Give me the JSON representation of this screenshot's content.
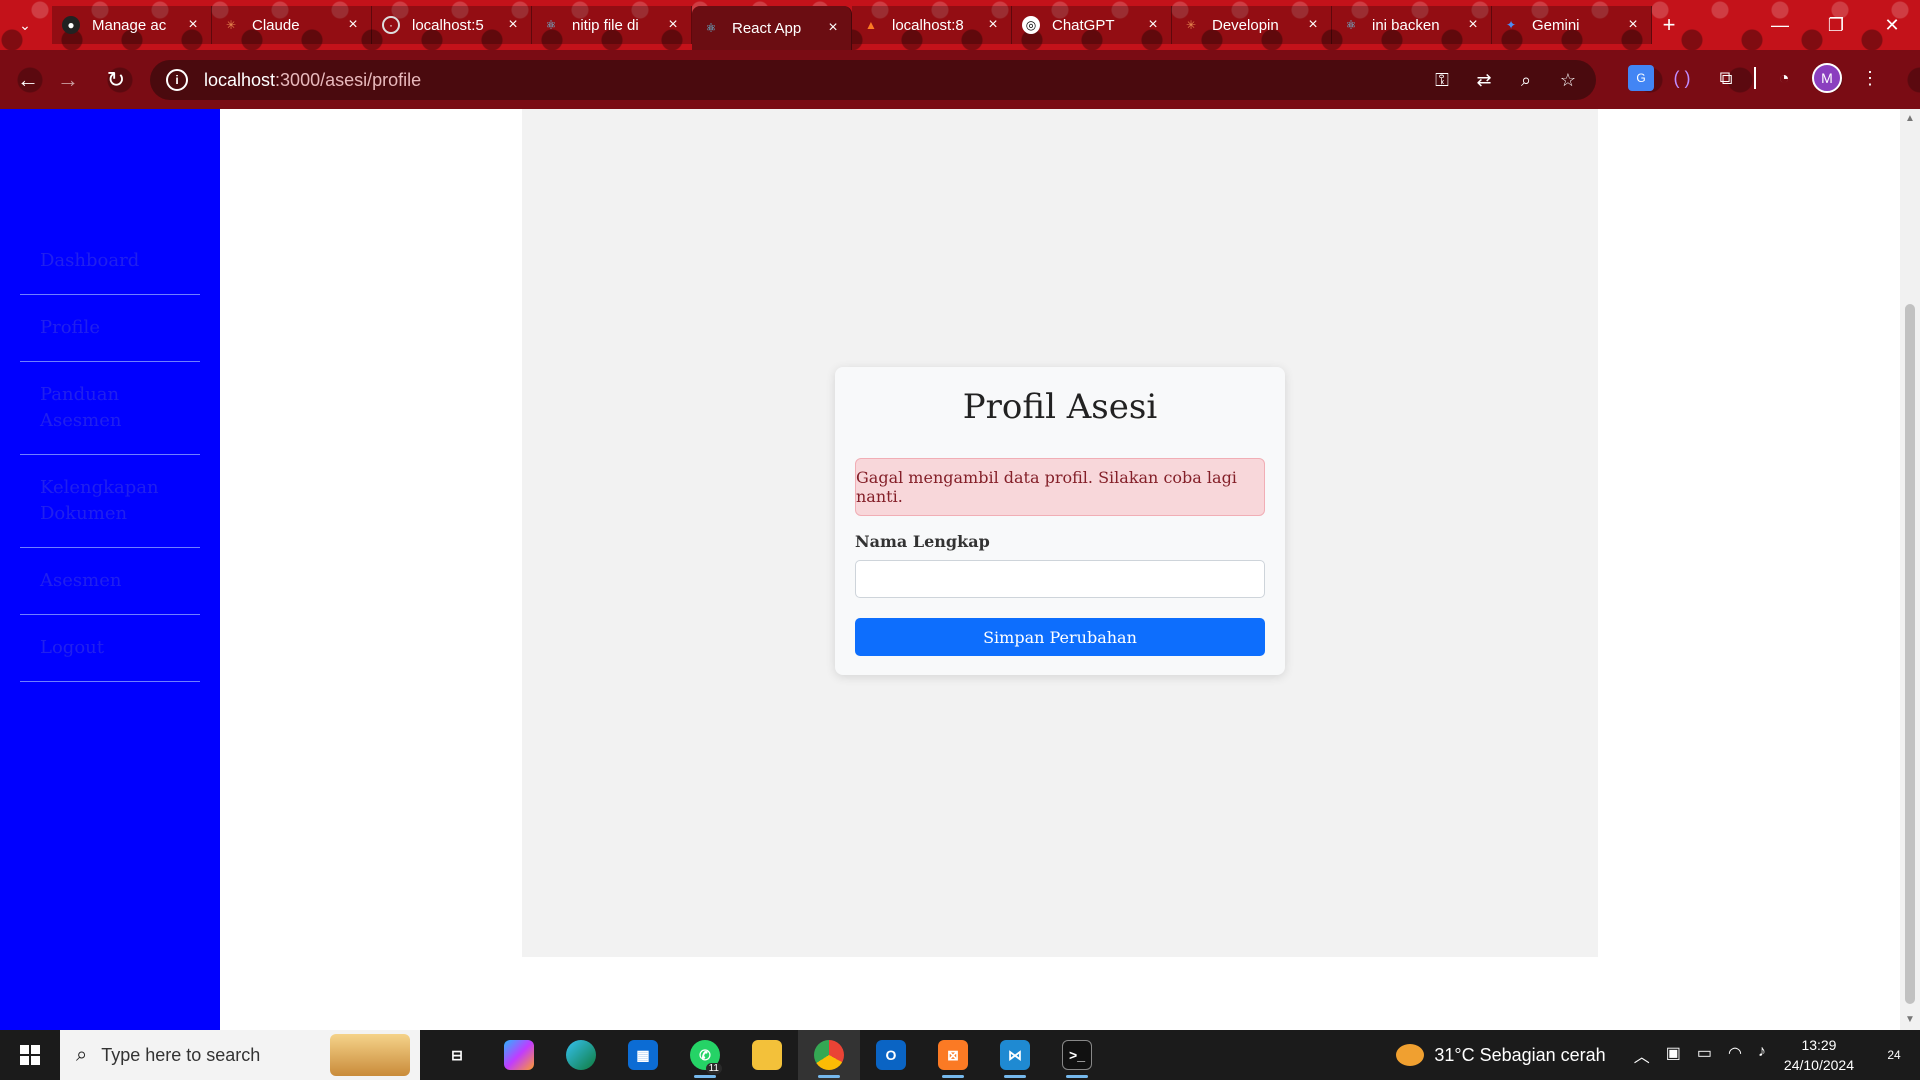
{
  "browser": {
    "tabs": [
      {
        "title": "Manage ac",
        "icon": "github-icon",
        "active": false
      },
      {
        "title": "Claude",
        "icon": "claude-icon",
        "active": false
      },
      {
        "title": "localhost:5",
        "icon": "globe-icon",
        "active": false
      },
      {
        "title": "nitip file di",
        "icon": "react-icon",
        "active": false
      },
      {
        "title": "React App",
        "icon": "react-icon",
        "active": true
      },
      {
        "title": "localhost:8",
        "icon": "xampp-icon",
        "active": false
      },
      {
        "title": "ChatGPT",
        "icon": "chatgpt-icon",
        "active": false
      },
      {
        "title": "Developin",
        "icon": "claude-icon",
        "active": false
      },
      {
        "title": "ini backen",
        "icon": "react-icon",
        "active": false
      },
      {
        "title": "Gemini",
        "icon": "gemini-icon",
        "active": false
      }
    ],
    "url_host": "localhost",
    "url_path": ":3000/asesi/profile",
    "profile_initial": "M"
  },
  "sidebar": {
    "items": [
      {
        "label": "Dashboard"
      },
      {
        "label": "Profile"
      },
      {
        "label": "Panduan Asesmen"
      },
      {
        "label": "Kelengkapan Dokumen"
      },
      {
        "label": "Asesmen"
      },
      {
        "label": "Logout"
      }
    ]
  },
  "profile": {
    "title": "Profil Asesi",
    "error_message": "Gagal mengambil data profil. Silakan coba lagi nanti.",
    "name_label": "Nama Lengkap",
    "name_value": "",
    "submit_label": "Simpan Perubahan"
  },
  "taskbar": {
    "search_placeholder": "Type here to search",
    "whatsapp_badge": "11",
    "weather": "31°C  Sebagian cerah",
    "time": "13:29",
    "date": "24/10/2024",
    "notification_count": "24"
  },
  "colors": {
    "sidebar_bg": "#0000ff",
    "primary_button": "#0d6efd",
    "alert_bg": "#f8d7da",
    "alert_text": "#842029"
  }
}
